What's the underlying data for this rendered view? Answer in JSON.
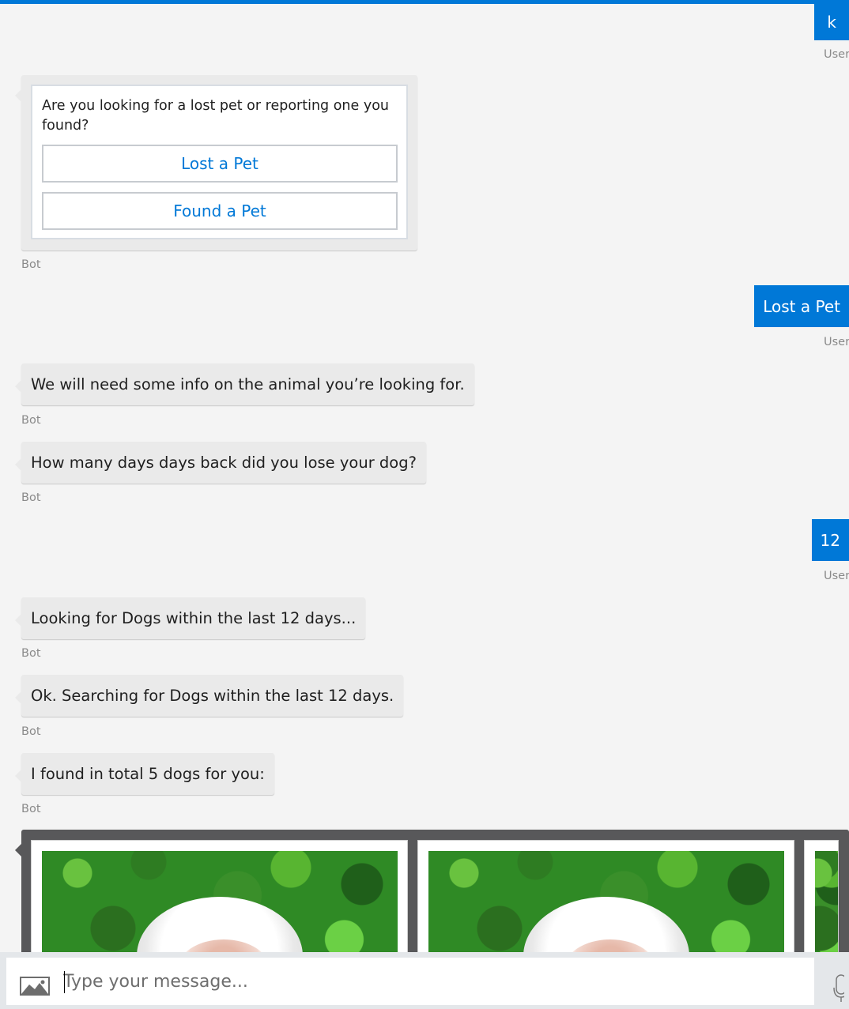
{
  "colors": {
    "accent": "#0078d7",
    "background": "#f4f4f4",
    "bot_bubble": "#eaeaea",
    "carousel_bg": "#58585a"
  },
  "messages": {
    "user_initial": {
      "text": "k",
      "sender": "User"
    },
    "hero_card": {
      "text": "Are you looking for a lost pet or reporting one you found?",
      "buttons": [
        "Lost a Pet",
        "Found a Pet"
      ],
      "sender": "Bot"
    },
    "user_lost_pet": {
      "text": "Lost a Pet",
      "sender": "User"
    },
    "bot_need_info": {
      "text": "We will need some info on the animal you’re looking for.",
      "sender": "Bot"
    },
    "bot_days_back": {
      "text": "How many days days back did you lose your dog?",
      "sender": "Bot"
    },
    "user_days": {
      "text": "12",
      "sender": "User"
    },
    "bot_looking": {
      "text": "Looking for Dogs within the last 12 days...",
      "sender": "Bot"
    },
    "bot_searching": {
      "text": "Ok. Searching for Dogs within the last 12 days.",
      "sender": "Bot"
    },
    "bot_found": {
      "text": "I found in total 5 dogs for you:",
      "sender": "Bot"
    }
  },
  "carousel": {
    "cards": [
      {
        "image": "white-dog-photo"
      },
      {
        "image": "white-dog-photo"
      },
      {
        "image": "white-dog-photo"
      }
    ]
  },
  "input_bar": {
    "placeholder": "Type your message...",
    "image_icon": "image-upload-icon",
    "mic_icon": "microphone-icon"
  }
}
